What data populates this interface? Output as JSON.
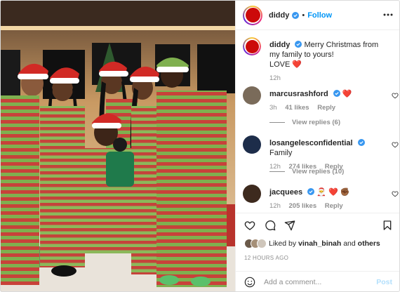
{
  "post": {
    "username": "diddy",
    "follow_label": "Follow",
    "caption_line1": "Merry Christmas from my family to yours!",
    "caption_line2": "LOVE ❤️",
    "caption_time": "12h"
  },
  "comments": [
    {
      "username": "marcusrashford",
      "text": "❤️",
      "time": "3h",
      "likes": "41 likes",
      "reply": "Reply",
      "view_replies": "View replies (6)"
    },
    {
      "username": "losangelesconfidential",
      "text": "Family",
      "time": "12h",
      "likes": "274 likes",
      "reply": "Reply",
      "view_replies": "View replies (10)"
    },
    {
      "username": "jacquees",
      "text": "🎅 ❤️ ✊🏾",
      "time": "12h",
      "likes": "205 likes",
      "reply": "Reply"
    }
  ],
  "likes_summary": {
    "prefix": "Liked by",
    "user": "vinah_binah",
    "joiner": "and",
    "suffix": "others"
  },
  "timestamp": "12 HOURS AGO",
  "comment_box": {
    "placeholder": "Add a comment...",
    "post_label": "Post"
  },
  "colors": {
    "accent": "#0095f6",
    "verified": "#3897f0",
    "heart": "#ed4956",
    "muted": "#8e8e8e"
  },
  "icons": [
    "heart-icon",
    "comment-icon",
    "share-icon",
    "bookmark-icon",
    "more-icon",
    "emoji-icon",
    "verified-icon"
  ]
}
